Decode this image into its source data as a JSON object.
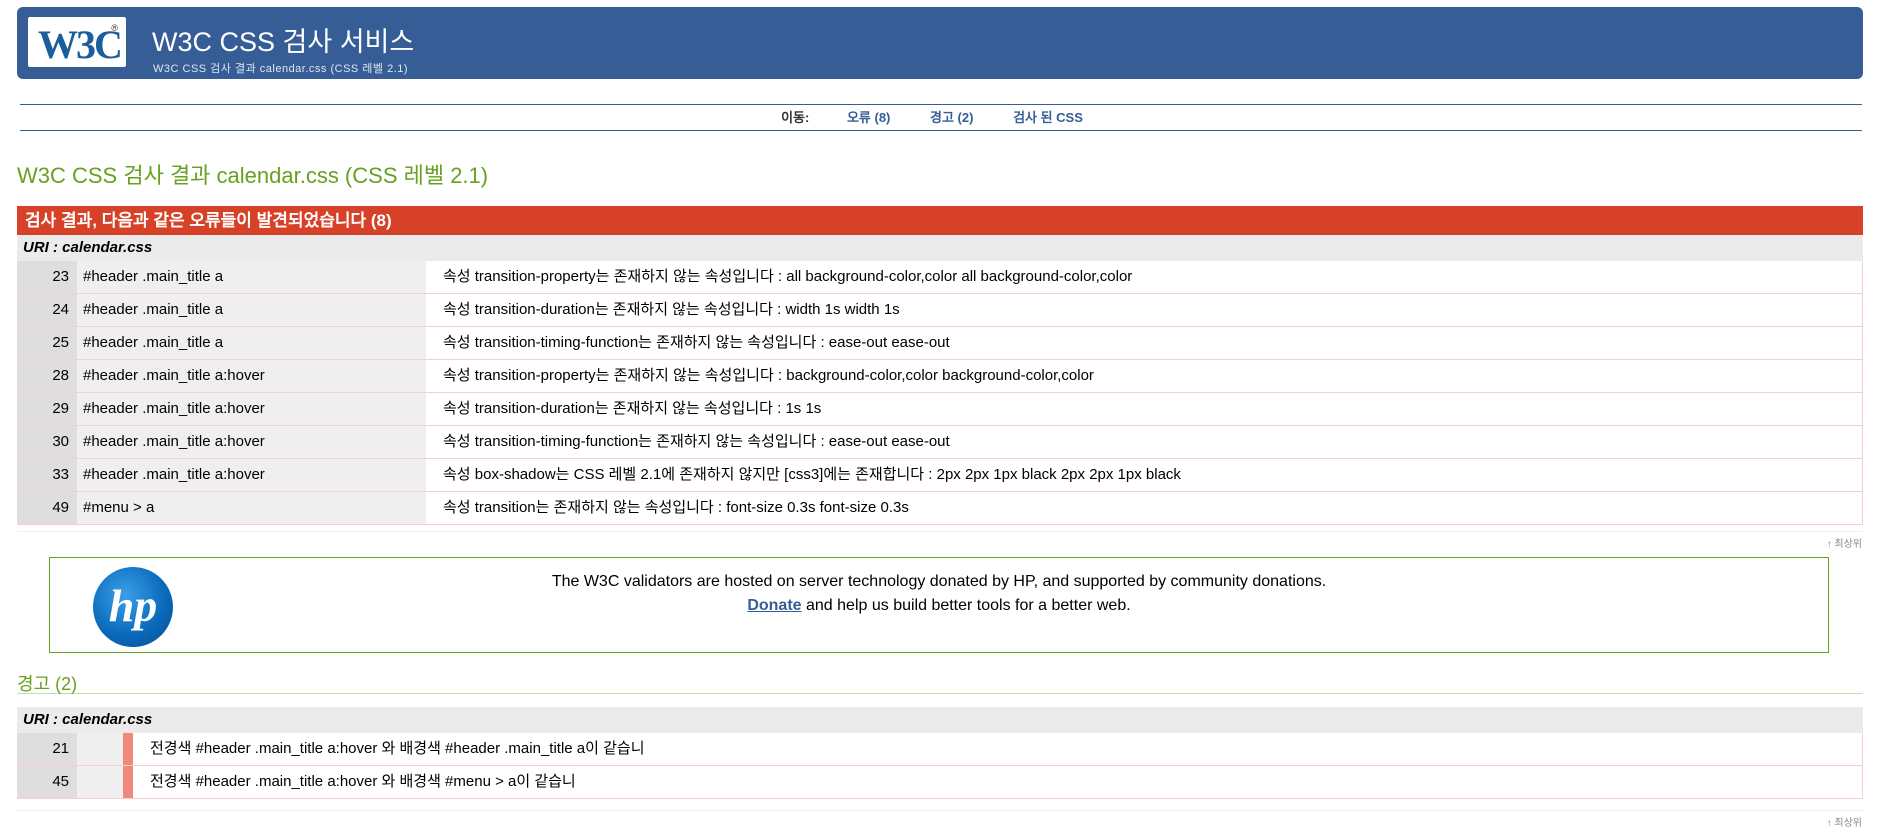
{
  "header": {
    "logo_text": "W3C",
    "logo_mark": "®",
    "title": "W3C CSS 검사 서비스",
    "subtitle": "W3C CSS 검사 결과 calendar.css (CSS 레벨 2.1)"
  },
  "nav": {
    "label": "이동:",
    "links": [
      "오류 (8)",
      "경고 (2)",
      "검사 된 CSS"
    ]
  },
  "page_title": "W3C CSS 검사 결과 calendar.css (CSS 레벨 2.1)",
  "errors": {
    "heading": "검사 결과, 다음과 같은 오류들이 발견되었습니다 (8)",
    "uri": "URI : calendar.css",
    "rows": [
      {
        "line": "23",
        "context": "#header .main_title a",
        "message": "속성 transition-property는 존재하지 않는 속성입니다 : all background-color,color all background-color,color"
      },
      {
        "line": "24",
        "context": "#header .main_title a",
        "message": "속성 transition-duration는 존재하지 않는 속성입니다 : width 1s width 1s"
      },
      {
        "line": "25",
        "context": "#header .main_title a",
        "message": "속성 transition-timing-function는 존재하지 않는 속성입니다 : ease-out ease-out"
      },
      {
        "line": "28",
        "context": "#header .main_title a:hover",
        "message": "속성 transition-property는 존재하지 않는 속성입니다 : background-color,color background-color,color"
      },
      {
        "line": "29",
        "context": "#header .main_title a:hover",
        "message": "속성 transition-duration는 존재하지 않는 속성입니다 : 1s 1s"
      },
      {
        "line": "30",
        "context": "#header .main_title a:hover",
        "message": "속성 transition-timing-function는 존재하지 않는 속성입니다 : ease-out ease-out"
      },
      {
        "line": "33",
        "context": "#header .main_title a:hover",
        "message": "속성 box-shadow는 CSS 레벨 2.1에 존재하지 않지만 [css3]에는 존재합니다 : 2px 2px 1px black 2px 2px 1px black"
      },
      {
        "line": "49",
        "context": "#menu > a",
        "message": "속성 transition는 존재하지 않는 속성입니다 : font-size 0.3s font-size 0.3s"
      }
    ],
    "top_link": "↑ 최상위"
  },
  "donation": {
    "logo_text": "hp",
    "line1": "The W3C validators are hosted on server technology donated by HP, and supported by community donations.",
    "donate_link": "Donate",
    "line2_rest": " and help us build better tools for a better web."
  },
  "warnings": {
    "heading": "경고 (2)",
    "uri": "URI : calendar.css",
    "rows": [
      {
        "line": "21",
        "message": "전경색 #header .main_title a:hover 와 배경색 #header .main_title a이 같습니"
      },
      {
        "line": "45",
        "message": "전경색 #header .main_title a:hover 와 배경색 #menu > a이 같습니"
      }
    ],
    "top_link": "↑ 최상위"
  },
  "colors": {
    "banner": "#365d95",
    "error_header": "#d64127",
    "title_green": "#67a120",
    "warning_bar": "#f2877c"
  }
}
